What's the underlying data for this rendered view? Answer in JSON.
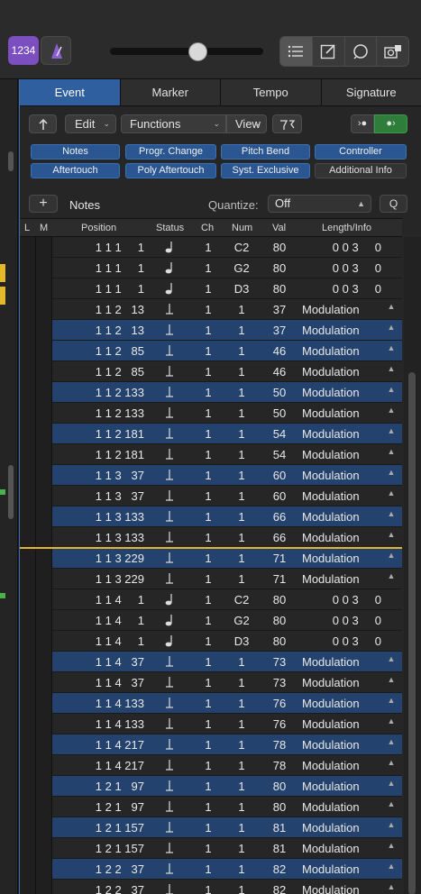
{
  "toolbar": {
    "lcd_text": "1234",
    "metronome_icon": "metronome-icon",
    "view_icons": [
      "list-icon",
      "notepad-icon",
      "loop-browser-icon",
      "media-browser-icon"
    ]
  },
  "tabs": [
    "Event",
    "Marker",
    "Tempo",
    "Signature"
  ],
  "edit_toolbar": {
    "up_icon": "parent-level-icon",
    "edit_label": "Edit",
    "functions_label": "Functions",
    "view_label": "View",
    "filter_icon": "filter-icon",
    "midi_out_icon": "midi-out-icon",
    "midi_in_icon": "midi-in-icon"
  },
  "filters": [
    {
      "label": "Notes",
      "on": true
    },
    {
      "label": "Progr. Change",
      "on": true
    },
    {
      "label": "Pitch Bend",
      "on": true
    },
    {
      "label": "Controller",
      "on": true
    },
    {
      "label": "Aftertouch",
      "on": true
    },
    {
      "label": "Poly Aftertouch",
      "on": true
    },
    {
      "label": "Syst. Exclusive",
      "on": true
    },
    {
      "label": "Additional Info",
      "on": false
    }
  ],
  "quantize_row": {
    "add_label": "+",
    "notes_label": "Notes",
    "quantize_label": "Quantize:",
    "quantize_value": "Off",
    "q_button": "Q"
  },
  "columns": [
    "L",
    "M",
    "Position",
    "Status",
    "Ch",
    "Num",
    "Val",
    "Length/Info"
  ],
  "rows": [
    {
      "pos": "1 1 1     1",
      "status": "note",
      "ch": "1",
      "num": "C2",
      "val": "80",
      "info": "0 0 3     0",
      "type": "note",
      "sel": false
    },
    {
      "pos": "1 1 1     1",
      "status": "note",
      "ch": "1",
      "num": "G2",
      "val": "80",
      "info": "0 0 3     0",
      "type": "note",
      "sel": false
    },
    {
      "pos": "1 1 1     1",
      "status": "note",
      "ch": "1",
      "num": "D3",
      "val": "80",
      "info": "0 0 3     0",
      "type": "note",
      "sel": false
    },
    {
      "pos": "1 1 2   13",
      "status": "ctrl",
      "ch": "1",
      "num": "1",
      "val": "37",
      "info": "Modulation",
      "type": "ctrl",
      "sel": false
    },
    {
      "pos": "1 1 2   13",
      "status": "ctrl",
      "ch": "1",
      "num": "1",
      "val": "37",
      "info": "Modulation",
      "type": "ctrl",
      "sel": true
    },
    {
      "pos": "1 1 2   85",
      "status": "ctrl",
      "ch": "1",
      "num": "1",
      "val": "46",
      "info": "Modulation",
      "type": "ctrl",
      "sel": true
    },
    {
      "pos": "1 1 2   85",
      "status": "ctrl",
      "ch": "1",
      "num": "1",
      "val": "46",
      "info": "Modulation",
      "type": "ctrl",
      "sel": false
    },
    {
      "pos": "1 1 2 133",
      "status": "ctrl",
      "ch": "1",
      "num": "1",
      "val": "50",
      "info": "Modulation",
      "type": "ctrl",
      "sel": true
    },
    {
      "pos": "1 1 2 133",
      "status": "ctrl",
      "ch": "1",
      "num": "1",
      "val": "50",
      "info": "Modulation",
      "type": "ctrl",
      "sel": false
    },
    {
      "pos": "1 1 2 181",
      "status": "ctrl",
      "ch": "1",
      "num": "1",
      "val": "54",
      "info": "Modulation",
      "type": "ctrl",
      "sel": true
    },
    {
      "pos": "1 1 2 181",
      "status": "ctrl",
      "ch": "1",
      "num": "1",
      "val": "54",
      "info": "Modulation",
      "type": "ctrl",
      "sel": false
    },
    {
      "pos": "1 1 3   37",
      "status": "ctrl",
      "ch": "1",
      "num": "1",
      "val": "60",
      "info": "Modulation",
      "type": "ctrl",
      "sel": true
    },
    {
      "pos": "1 1 3   37",
      "status": "ctrl",
      "ch": "1",
      "num": "1",
      "val": "60",
      "info": "Modulation",
      "type": "ctrl",
      "sel": false
    },
    {
      "pos": "1 1 3 133",
      "status": "ctrl",
      "ch": "1",
      "num": "1",
      "val": "66",
      "info": "Modulation",
      "type": "ctrl",
      "sel": true
    },
    {
      "pos": "1 1 3 133",
      "status": "ctrl",
      "ch": "1",
      "num": "1",
      "val": "66",
      "info": "Modulation",
      "type": "ctrl",
      "sel": false
    },
    {
      "pos": "1 1 3 229",
      "status": "ctrl",
      "ch": "1",
      "num": "1",
      "val": "71",
      "info": "Modulation",
      "type": "ctrl",
      "sel": true
    },
    {
      "pos": "1 1 3 229",
      "status": "ctrl",
      "ch": "1",
      "num": "1",
      "val": "71",
      "info": "Modulation",
      "type": "ctrl",
      "sel": false
    },
    {
      "pos": "1 1 4     1",
      "status": "note",
      "ch": "1",
      "num": "C2",
      "val": "80",
      "info": "0 0 3     0",
      "type": "note",
      "sel": false
    },
    {
      "pos": "1 1 4     1",
      "status": "note",
      "ch": "1",
      "num": "G2",
      "val": "80",
      "info": "0 0 3     0",
      "type": "note",
      "sel": false
    },
    {
      "pos": "1 1 4     1",
      "status": "note",
      "ch": "1",
      "num": "D3",
      "val": "80",
      "info": "0 0 3     0",
      "type": "note",
      "sel": false
    },
    {
      "pos": "1 1 4   37",
      "status": "ctrl",
      "ch": "1",
      "num": "1",
      "val": "73",
      "info": "Modulation",
      "type": "ctrl",
      "sel": true
    },
    {
      "pos": "1 1 4   37",
      "status": "ctrl",
      "ch": "1",
      "num": "1",
      "val": "73",
      "info": "Modulation",
      "type": "ctrl",
      "sel": false
    },
    {
      "pos": "1 1 4 133",
      "status": "ctrl",
      "ch": "1",
      "num": "1",
      "val": "76",
      "info": "Modulation",
      "type": "ctrl",
      "sel": true
    },
    {
      "pos": "1 1 4 133",
      "status": "ctrl",
      "ch": "1",
      "num": "1",
      "val": "76",
      "info": "Modulation",
      "type": "ctrl",
      "sel": false
    },
    {
      "pos": "1 1 4 217",
      "status": "ctrl",
      "ch": "1",
      "num": "1",
      "val": "78",
      "info": "Modulation",
      "type": "ctrl",
      "sel": true
    },
    {
      "pos": "1 1 4 217",
      "status": "ctrl",
      "ch": "1",
      "num": "1",
      "val": "78",
      "info": "Modulation",
      "type": "ctrl",
      "sel": false
    },
    {
      "pos": "1 2 1   97",
      "status": "ctrl",
      "ch": "1",
      "num": "1",
      "val": "80",
      "info": "Modulation",
      "type": "ctrl",
      "sel": true
    },
    {
      "pos": "1 2 1   97",
      "status": "ctrl",
      "ch": "1",
      "num": "1",
      "val": "80",
      "info": "Modulation",
      "type": "ctrl",
      "sel": false
    },
    {
      "pos": "1 2 1 157",
      "status": "ctrl",
      "ch": "1",
      "num": "1",
      "val": "81",
      "info": "Modulation",
      "type": "ctrl",
      "sel": true
    },
    {
      "pos": "1 2 1 157",
      "status": "ctrl",
      "ch": "1",
      "num": "1",
      "val": "81",
      "info": "Modulation",
      "type": "ctrl",
      "sel": false
    },
    {
      "pos": "1 2 2   37",
      "status": "ctrl",
      "ch": "1",
      "num": "1",
      "val": "82",
      "info": "Modulation",
      "type": "ctrl",
      "sel": true
    },
    {
      "pos": "1 2 2   37",
      "status": "ctrl",
      "ch": "1",
      "num": "1",
      "val": "82",
      "info": "Modulation",
      "type": "ctrl",
      "sel": false
    }
  ],
  "colors": {
    "accent": "#2f5f9e",
    "selected_row": "#23426d",
    "lcd": "#7b4fbf",
    "playhead": "#e2b52a"
  }
}
